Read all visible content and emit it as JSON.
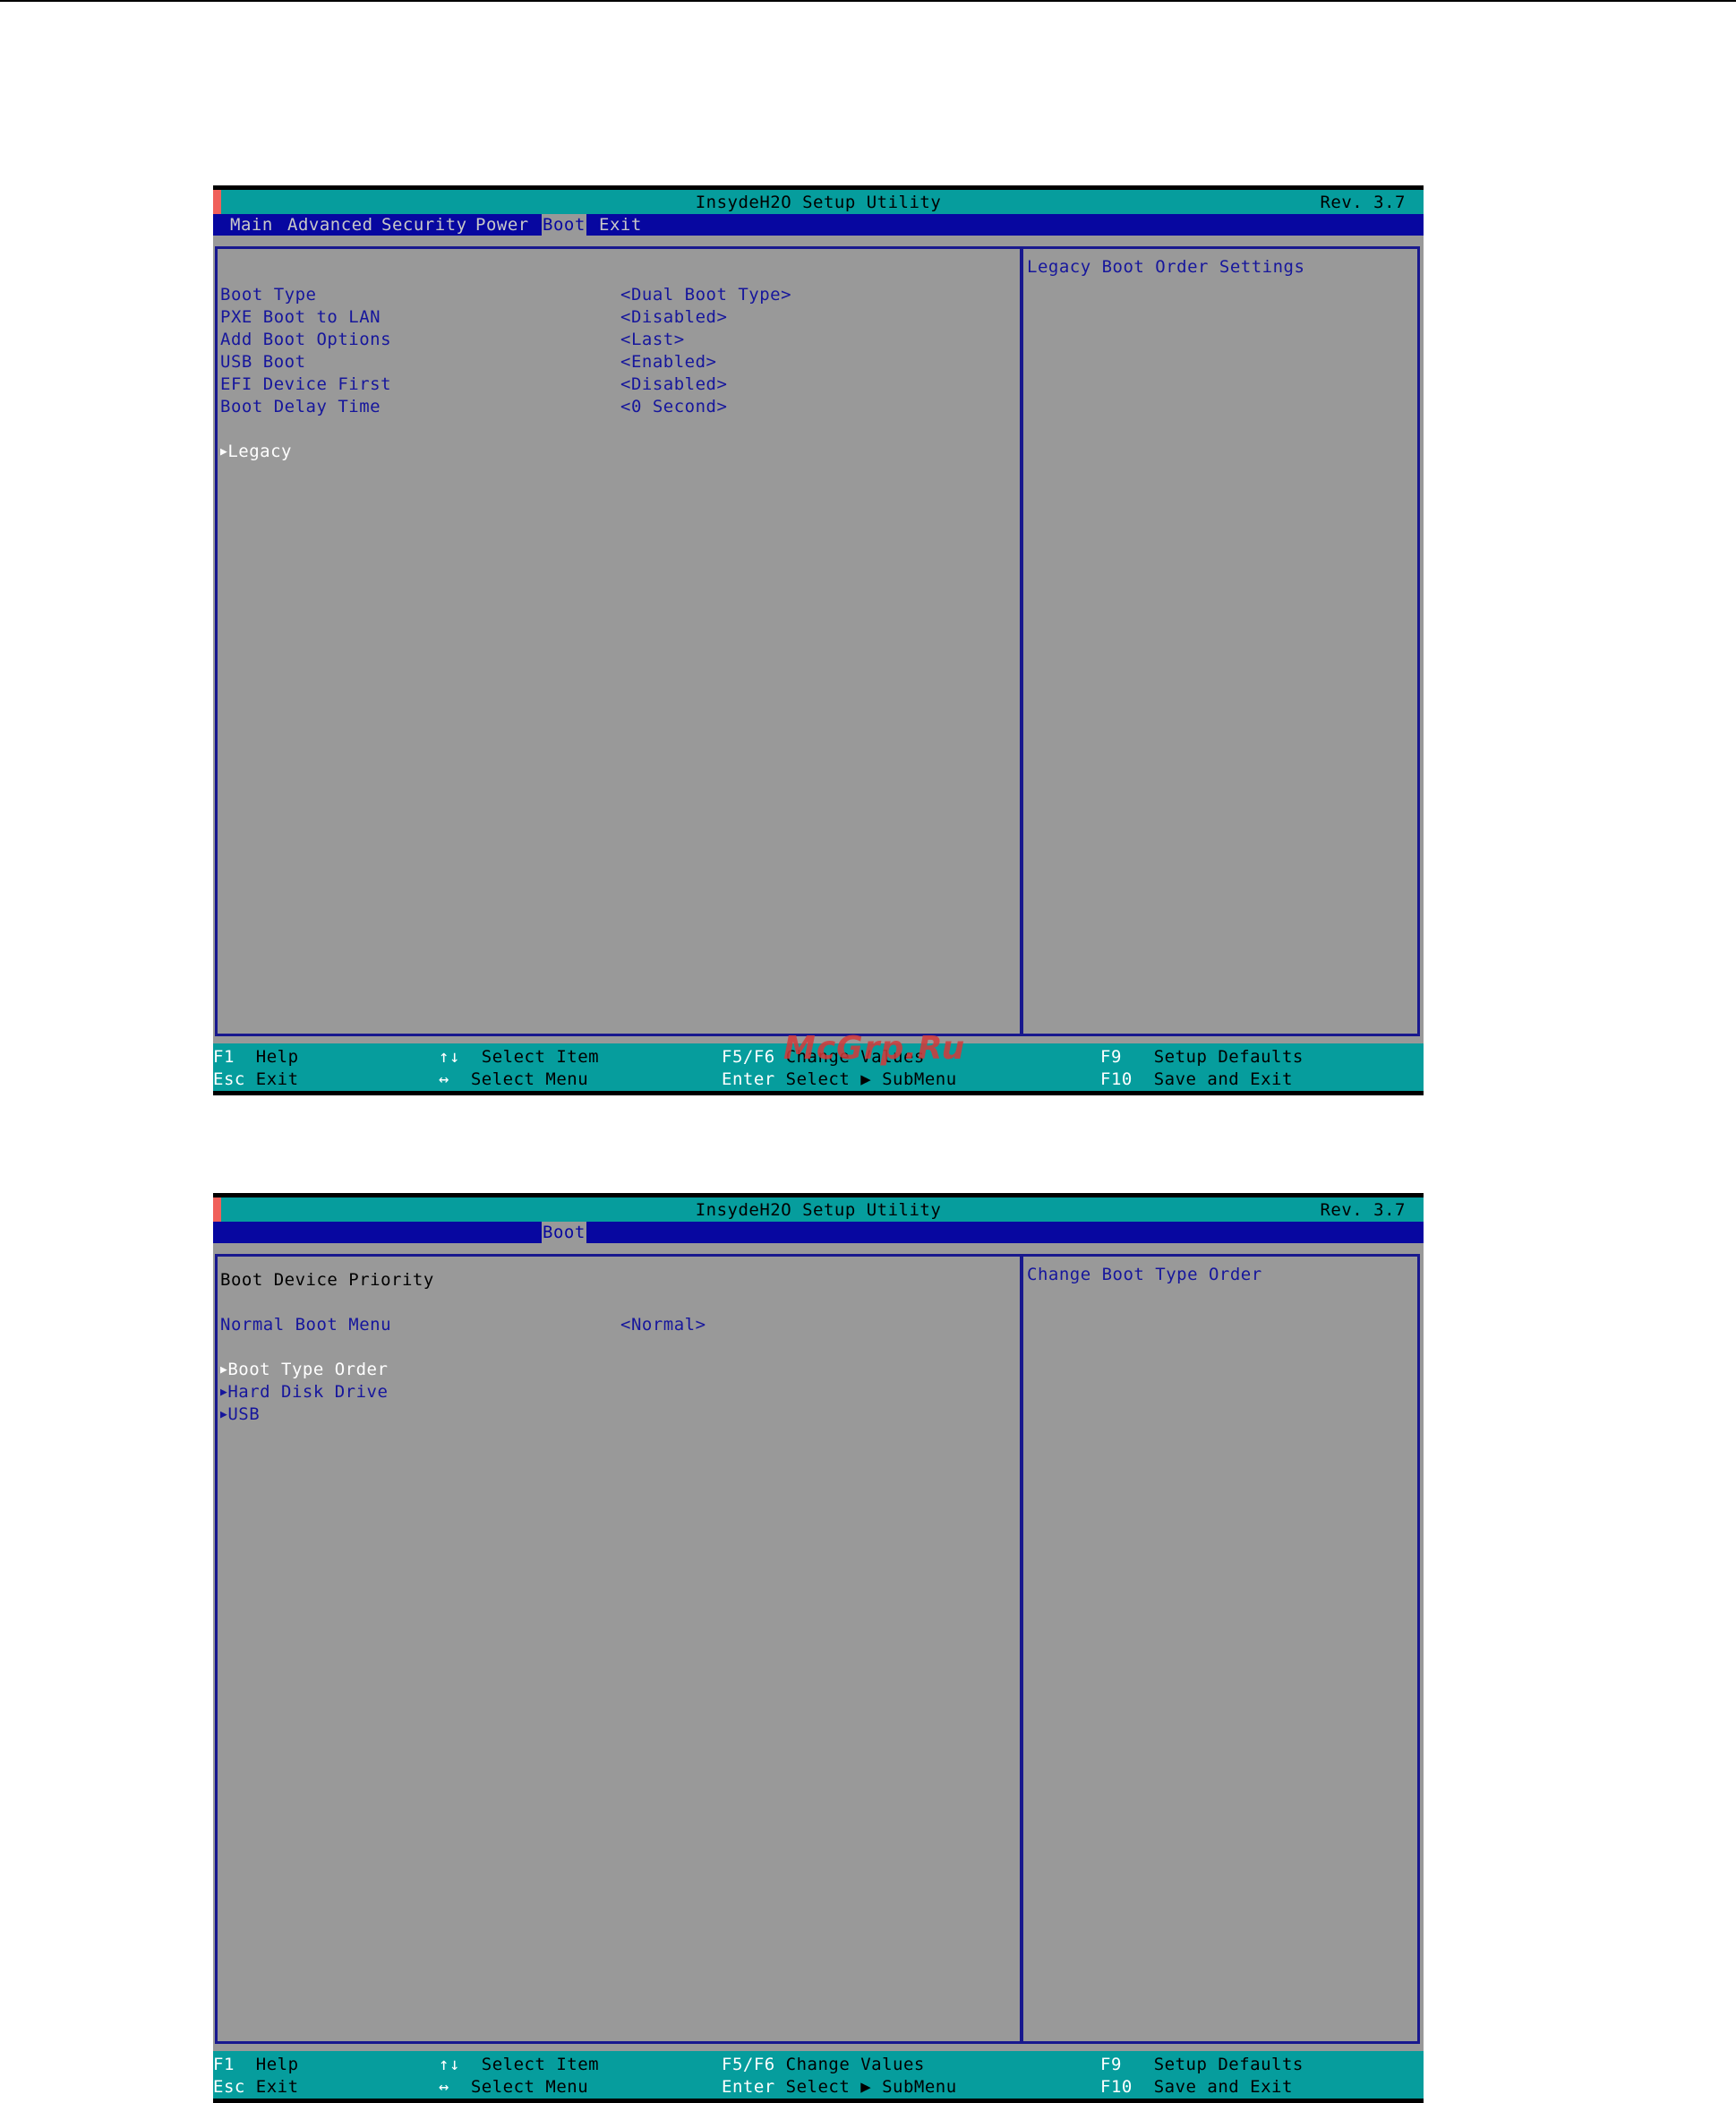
{
  "screens": [
    {
      "title": "InsydeH2O Setup Utility",
      "revision": "Rev. 3.7",
      "tabs": [
        "Main",
        "Advanced",
        "Security",
        "Power",
        "Boot",
        "Exit"
      ],
      "active_tab": "Boot",
      "settings": [
        {
          "label": "Boot Type",
          "value": "<Dual Boot Type>"
        },
        {
          "label": "PXE Boot to LAN",
          "value": "<Disabled>"
        },
        {
          "label": "Add Boot Options",
          "value": "<Last>"
        },
        {
          "label": "USB Boot",
          "value": "<Enabled>"
        },
        {
          "label": "EFI Device First",
          "value": "<Disabled>"
        },
        {
          "label": "Boot Delay Time",
          "value": "<0 Second>"
        }
      ],
      "submenus": [
        "Legacy"
      ],
      "help": "Legacy Boot Order Settings"
    },
    {
      "title": "InsydeH2O Setup Utility",
      "revision": "Rev. 3.7",
      "active_tab": "Boot",
      "section_heading": "Boot Device Priority",
      "settings": [
        {
          "label": "Normal Boot Menu",
          "value": "<Normal>"
        }
      ],
      "submenus": [
        "Boot Type Order",
        "Hard Disk Drive",
        "USB"
      ],
      "help": "Change Boot Type Order"
    }
  ],
  "footer": {
    "f1_key": "F1",
    "f1_desc": "Help",
    "esc_key": "Esc",
    "esc_desc": "Exit",
    "updown_key": "↑↓",
    "updown_desc": "Select Item",
    "leftright_key": "↔",
    "leftright_desc": "Select Menu",
    "f5f6_key": "F5/F6",
    "f5f6_desc": "Change Values",
    "enter_key": "Enter",
    "enter_desc": "Select ▶ SubMenu",
    "f9_key": "F9",
    "f9_desc": "Setup Defaults",
    "f10_key": "F10",
    "f10_desc": "Save and Exit"
  },
  "watermark": "McGrp.Ru",
  "colors": {
    "background": "#999999",
    "title_bar": "#069d9d",
    "menu_bar": "#0707a0",
    "item_text": "#16169c",
    "selected_text": "#ffffff",
    "title_marker": "#f0605a"
  }
}
